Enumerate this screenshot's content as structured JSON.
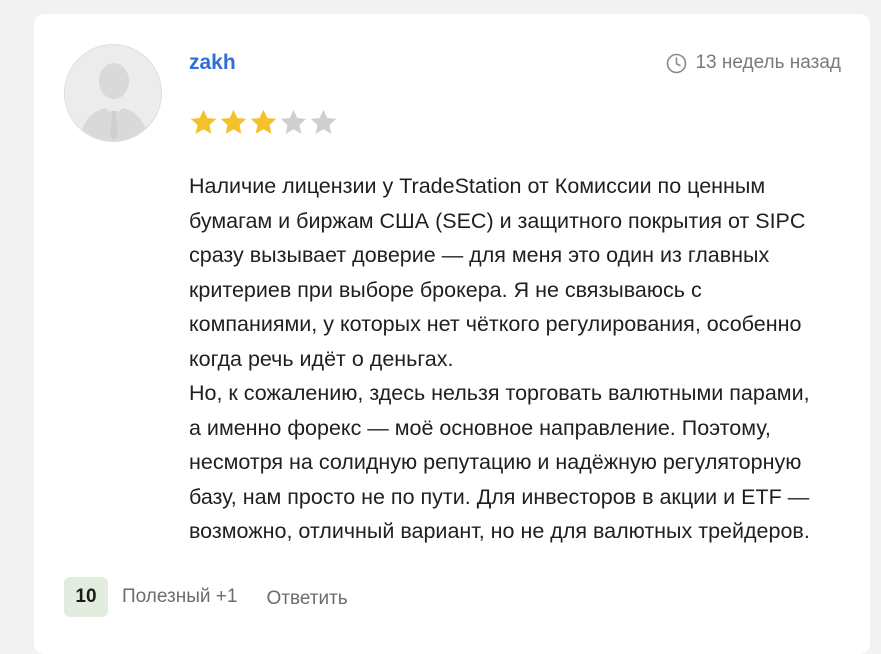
{
  "review": {
    "author": "zakh",
    "timestamp": "13 недель назад",
    "rating": 3,
    "rating_max": 5,
    "text_lines": [
      "Наличие лицензии у TradeStation от Комиссии по ценным",
      "бумагам и биржам США (SEC) и защитного покрытия от SIPC",
      "сразу вызывает доверие — для меня это один из главных",
      "критериев при выборе брокера. Я не связываюсь с",
      "компаниями, у которых нет чёткого регулирования, особенно",
      "когда речь идёт о деньгах.",
      "Но, к сожалению, здесь нельзя торговать валютными парами,",
      "а именно форекс — моё основное направление. Поэтому,",
      "несмотря на солидную репутацию и надёжную регуляторную",
      "базу, нам просто не по пути. Для инвесторов в акции и ETF —",
      "возможно, отличный вариант, но не для валютных трейдеров."
    ]
  },
  "footer": {
    "vote_count": "10",
    "useful_label": "Полезный +1",
    "reply_label": "Ответить"
  },
  "colors": {
    "star_filled": "#f5c12b",
    "star_empty": "#cfcfcf",
    "username": "#2f6fd8",
    "vote_badge_bg": "#e2ecdf"
  },
  "icons": {
    "clock": "clock-icon",
    "avatar": "user-silhouette-icon",
    "star": "star-icon"
  }
}
